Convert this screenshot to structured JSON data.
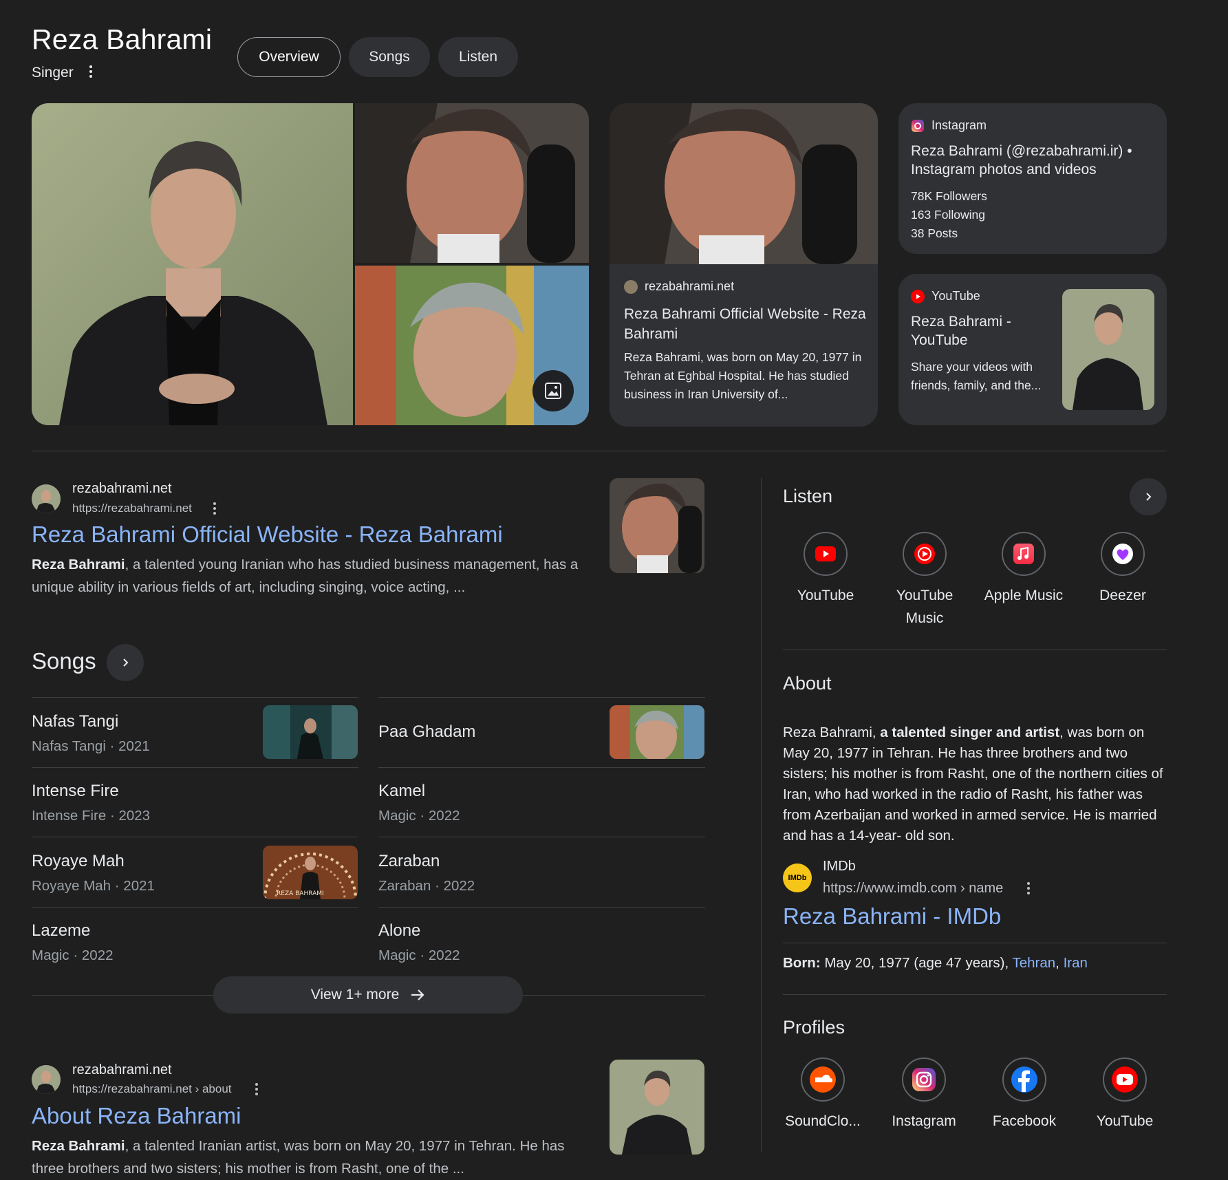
{
  "header": {
    "title": "Reza Bahrami",
    "subtitle": "Singer",
    "tabs": [
      {
        "label": "Overview",
        "active": true
      },
      {
        "label": "Songs",
        "active": false
      },
      {
        "label": "Listen",
        "active": false
      }
    ]
  },
  "cards": {
    "website": {
      "source": "rezabahrami.net",
      "title": "Reza Bahrami Official Website - Reza Bahrami",
      "text": "Reza Bahrami, was born on May 20, 1977 in Tehran at Eghbal Hospital. He has studied business in Iran University of..."
    },
    "instagram": {
      "source": "Instagram",
      "title": "Reza Bahrami (@rezabahrami.ir) • Instagram photos and videos",
      "stats": [
        "78K Followers",
        "163 Following",
        "38 Posts"
      ]
    },
    "youtube": {
      "source": "YouTube",
      "title": "Reza Bahrami - YouTube",
      "text": "Share your videos with friends, family, and the..."
    }
  },
  "result1": {
    "site": "rezabahrami.net",
    "url": "https://rezabahrami.net",
    "title": "Reza Bahrami Official Website - Reza Bahrami",
    "snippet_bold": "Reza Bahrami",
    "snippet": ", a talented young Iranian who has studied business management, has a unique ability in various fields of art, including singing, voice acting, ..."
  },
  "songs": {
    "title": "Songs",
    "items": [
      {
        "name": "Nafas Tangi",
        "meta": "Nafas Tangi · 2021"
      },
      {
        "name": "Paa Ghadam",
        "meta": ""
      },
      {
        "name": "Intense Fire",
        "meta": "Intense Fire · 2023"
      },
      {
        "name": "Kamel",
        "meta": "Magic · 2022"
      },
      {
        "name": "Royaye Mah",
        "meta": "Royaye Mah · 2021"
      },
      {
        "name": "Zaraban",
        "meta": "Zaraban · 2022"
      },
      {
        "name": "Lazeme",
        "meta": "Magic · 2022"
      },
      {
        "name": "Alone",
        "meta": "Magic · 2022"
      }
    ],
    "thumb_text": "REZA BAHRAMI",
    "view_more": "View 1+ more"
  },
  "result2": {
    "site": "rezabahrami.net",
    "url": "https://rezabahrami.net › about",
    "title": "About Reza Bahrami",
    "snippet_bold": "Reza Bahrami",
    "snippet": ", a talented Iranian artist, was born on May 20, 1977 in Tehran. He has three brothers and two sisters; his mother is from Rasht, one of the ..."
  },
  "listen": {
    "title": "Listen",
    "apps": [
      {
        "label": "YouTube",
        "icon": "youtube-icon"
      },
      {
        "label": "YouTube Music",
        "icon": "youtube-music-icon"
      },
      {
        "label": "Apple Music",
        "icon": "apple-music-icon"
      },
      {
        "label": "Deezer",
        "icon": "deezer-icon"
      }
    ]
  },
  "about": {
    "title": "About",
    "text_pre": "Reza Bahrami, ",
    "text_bold": "a talented singer and artist",
    "text_post": ", was born on May 20, 1977 in Tehran. He has three brothers and two sisters; his mother is from Rasht, one of the northern cities of Iran, who had worked in the radio of Rasht, his father was from Azerbaijan and worked in armed service. He is married and has a 14-year- old son.",
    "source_name": "IMDb",
    "source_logo": "IMDb",
    "source_url": "https://www.imdb.com › name",
    "source_title": "Reza Bahrami - IMDb",
    "born_label": "Born:",
    "born_value": " May 20, 1977 (age 47 years), ",
    "born_city": "Tehran",
    "born_sep": ", ",
    "born_country": "Iran"
  },
  "profiles": {
    "title": "Profiles",
    "items": [
      {
        "label": "SoundClo...",
        "icon": "soundcloud-icon"
      },
      {
        "label": "Instagram",
        "icon": "instagram-icon"
      },
      {
        "label": "Facebook",
        "icon": "facebook-icon"
      },
      {
        "label": "YouTube",
        "icon": "youtube-icon"
      }
    ]
  },
  "colors": {
    "background": "#1f1f1f",
    "card": "#303134",
    "link": "#8ab4f8",
    "youtube_red": "#ff0000"
  }
}
